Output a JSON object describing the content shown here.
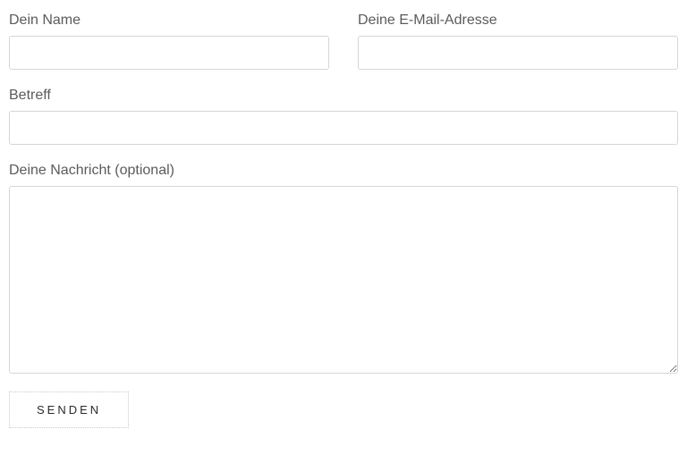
{
  "form": {
    "name_label": "Dein Name",
    "email_label": "Deine E-Mail-Adresse",
    "subject_label": "Betreff",
    "message_label": "Deine Nachricht (optional)",
    "name_value": "",
    "email_value": "",
    "subject_value": "",
    "message_value": "",
    "submit_label": "Senden"
  }
}
